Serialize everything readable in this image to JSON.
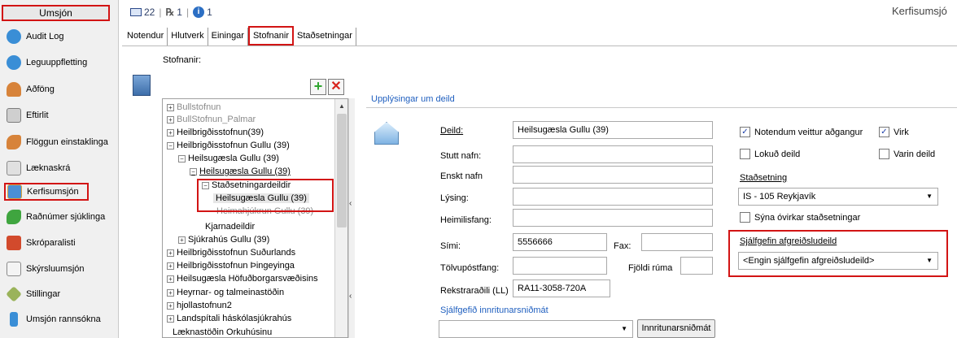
{
  "sidebar": {
    "title": "Umsjón",
    "items": [
      {
        "label": "Audit Log",
        "icon": "globe-icon",
        "color": "#3a8ed6"
      },
      {
        "label": "Leguuppfletting",
        "icon": "globe-icon",
        "color": "#3a8ed6"
      },
      {
        "label": "Aðföng",
        "icon": "person-icon",
        "color": "#d7833a"
      },
      {
        "label": "Eftirlit",
        "icon": "gear-document-icon",
        "color": "#7c7c7c"
      },
      {
        "label": "Flöggun einstaklinga",
        "icon": "people-icon",
        "color": "#d7833a"
      },
      {
        "label": "Læknaskrá",
        "icon": "computer-icon",
        "color": "#8a8a8a"
      },
      {
        "label": "Kerfisumsjón",
        "icon": "screen-person-icon",
        "color": "#4a8fd4"
      },
      {
        "label": "Raðnúmer sjúklinga",
        "icon": "people-icon",
        "color": "#3fa53f"
      },
      {
        "label": "Skróparalisti",
        "icon": "calendar-icon",
        "color": "#d24a2c"
      },
      {
        "label": "Skýrsluumsjón",
        "icon": "report-icon",
        "color": "#8a8a8a"
      },
      {
        "label": "Stillingar",
        "icon": "tools-icon",
        "color": "#7c9a3a"
      },
      {
        "label": "Umsjón rannsókna",
        "icon": "microscope-icon",
        "color": "#3a8ed6"
      }
    ]
  },
  "topbar": {
    "mail_count": "22",
    "rx_count": "1",
    "info_count": "1",
    "app_title": "Kerfisumsjó"
  },
  "tabs": [
    "Notendur",
    "Hlutverk",
    "Einingar",
    "Stofnanir",
    "Staðsetningar"
  ],
  "tree": {
    "title": "Stofnanir:",
    "nodes": [
      "Bullstofnun",
      "BullStofnun_Palmar",
      "Heilbrigðisstofnun(39)",
      "Heilbrigðisstofnun Gullu (39)",
      "Heilsugæsla Gullu (39)",
      "Heilsugæsla Gullu (39)",
      "Staðsetningardeildir",
      "Heilsugæsla Gullu (39)",
      "Heimahjúkrun Gullu (39)",
      "Kjarnadeildir",
      "Sjúkrahús Gullu (39)",
      "Heilbrigðisstofnun Suðurlands",
      "Heilbrigðisstofnun Þingeyinga",
      "Heilsugæsla Höfuðborgarsvæðisins",
      "Heyrnar- og talmeinastöðin",
      "hjollastofnun2",
      "Landspítali háskólasjúkrahús",
      "Læknastöðin Orkuhúsinu"
    ]
  },
  "form": {
    "section_title": "Upplýsingar um deild",
    "deild_label": "Deild:",
    "deild_value": "Heilsugæsla Gullu (39)",
    "stutt_label": "Stutt nafn:",
    "enskt_label": "Enskt nafn",
    "lysing_label": "Lýsing:",
    "heimilisfang_label": "Heimilisfang:",
    "simi_label": "Sími:",
    "simi_value": "5556666",
    "fax_label": "Fax:",
    "tolvupostfang_label": "Tölvupóstfang:",
    "fjoldi_label": "Fjöldi rúma",
    "rekstrar_label": "Rekstraraðili (LL)",
    "rekstrar_value": "RA11-3058-720A",
    "innritun_label": "Sjálfgefið innritunarsniðmát",
    "innritun_button": "Innritunarsniðmát",
    "notendum_label": "Notendum veittur aðgangur",
    "virk_label": "Virk",
    "lokud_label": "Lokuð deild",
    "varin_label": "Varin deild",
    "stadsetning_label": "Staðsetning",
    "stadsetning_value": "IS - 105 Reykjavík",
    "ovirkar_label": "Sýna óvirkar staðsetningar",
    "sjalfgefin_label": "Sjálfgefin afgreiðsludeild",
    "sjalfgefin_value": "<Engin sjálfgefin afgreiðsludeild>"
  },
  "colors": {
    "highlight": "#d21414",
    "link": "#1f5fbf",
    "sidebar_bg": "#f0f0f0"
  }
}
